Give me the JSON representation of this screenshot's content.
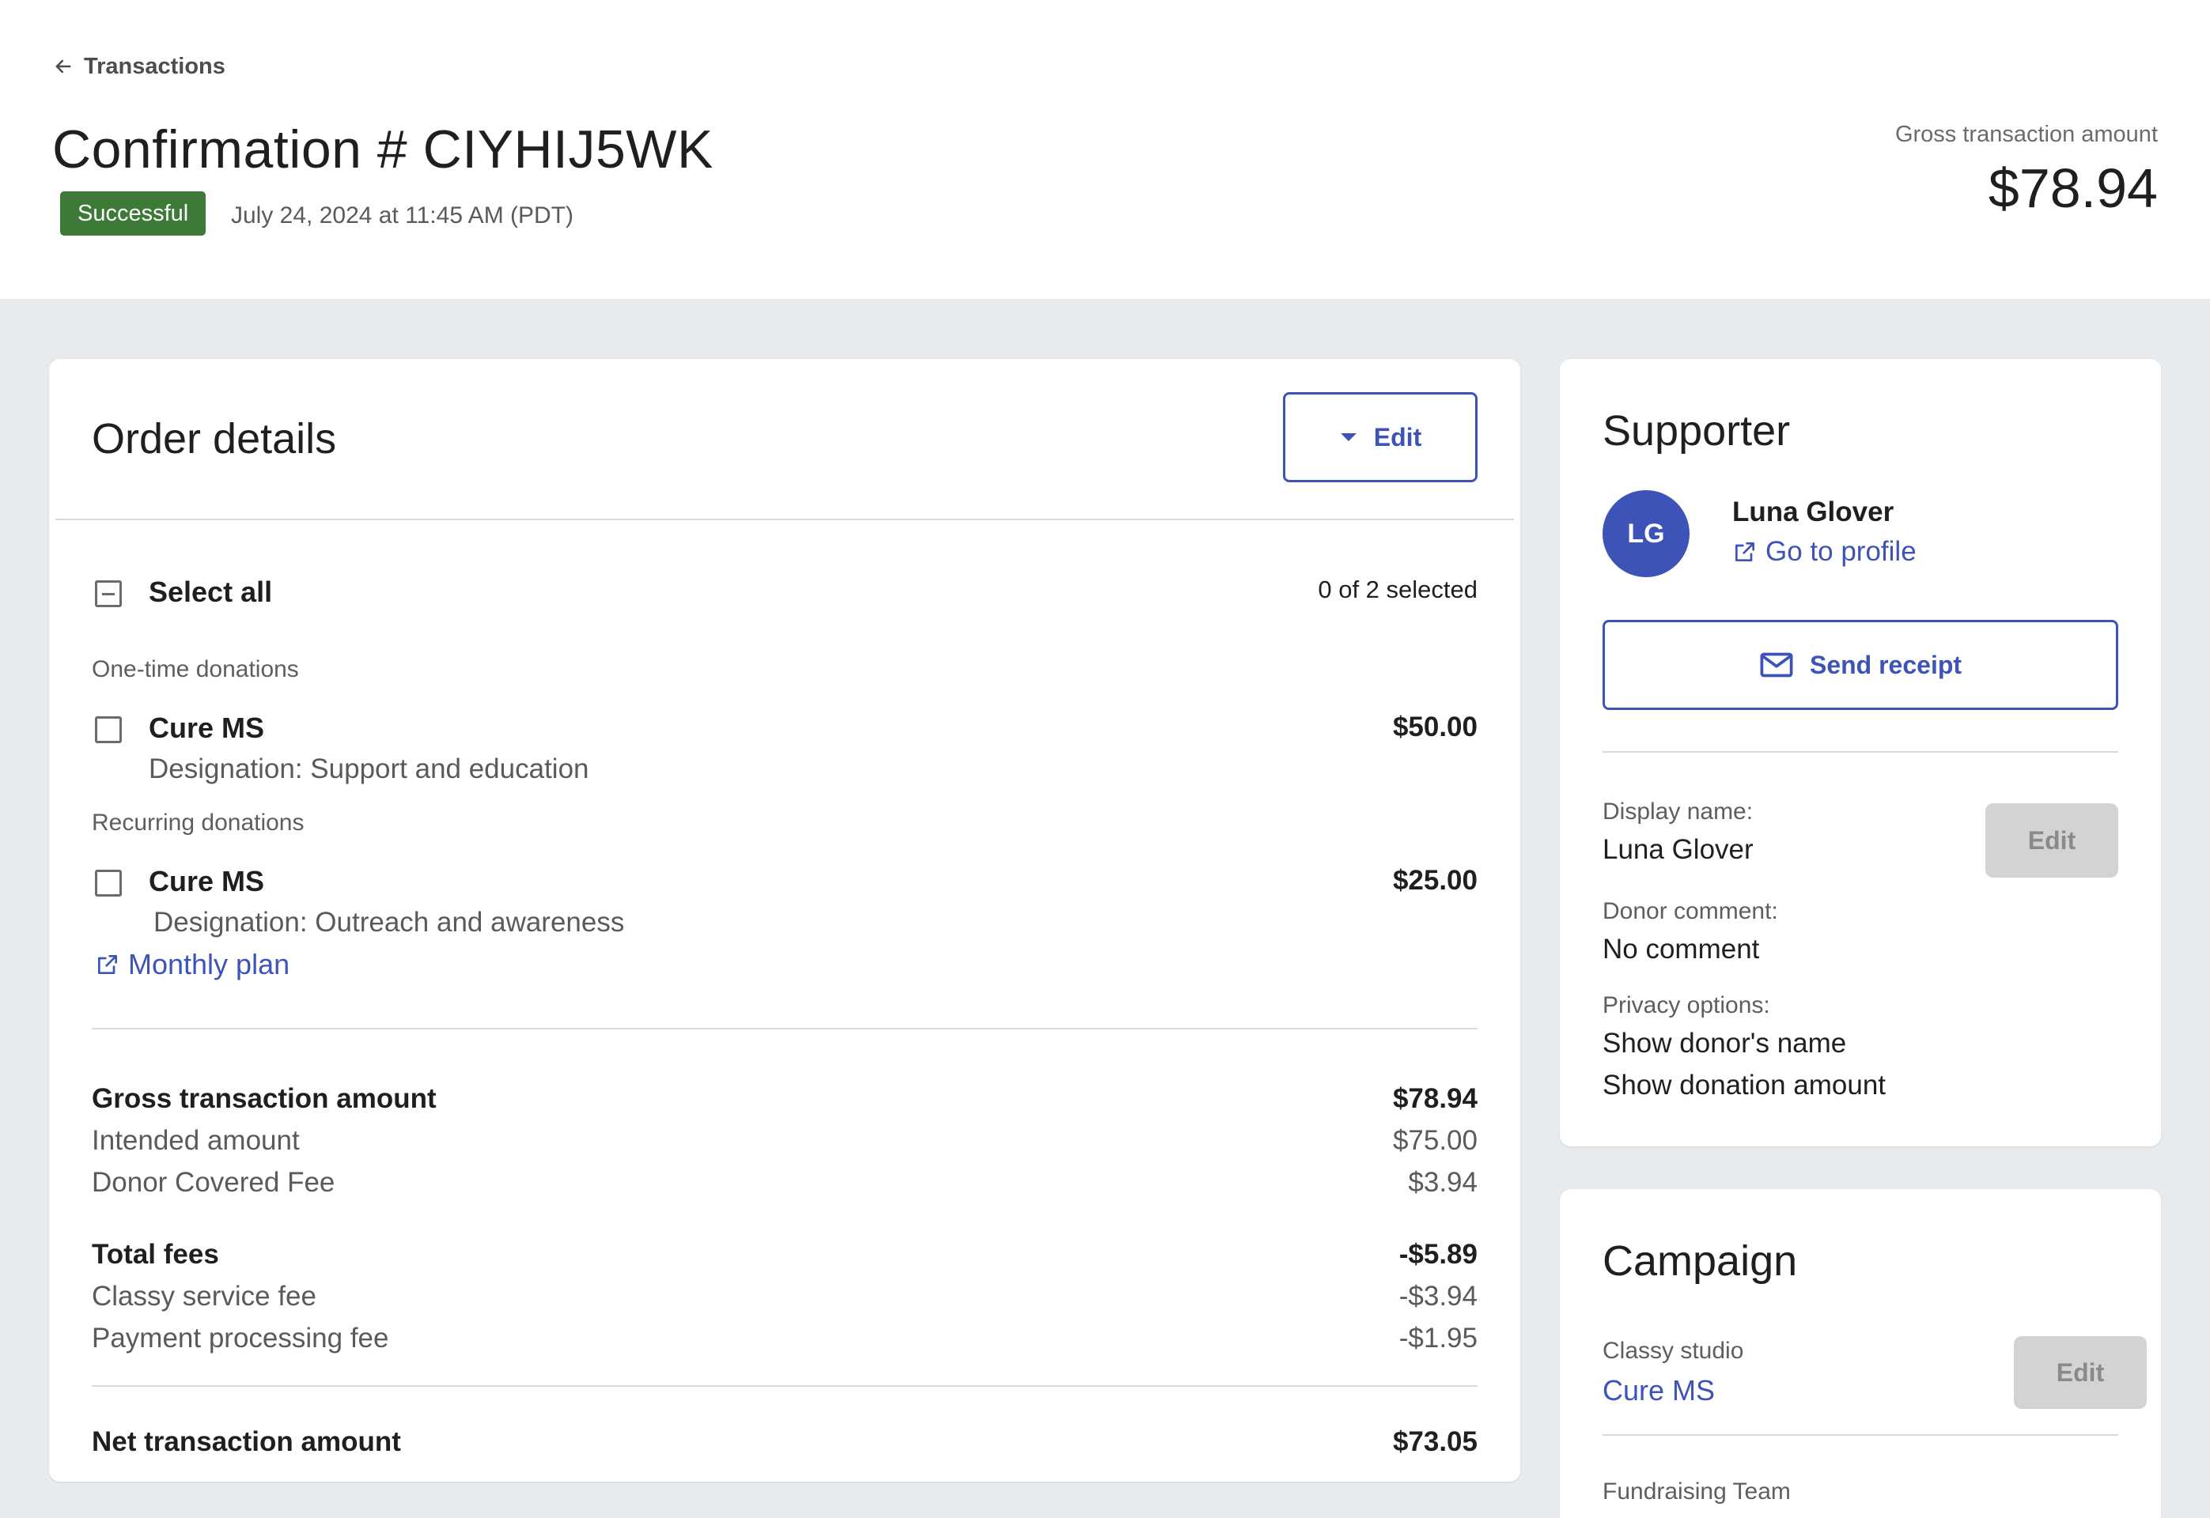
{
  "header": {
    "back_label": "Transactions",
    "title": "Confirmation # CIYHIJ5WK",
    "status": "Successful",
    "date": "July 24, 2024 at 11:45 AM (PDT)",
    "gross_label": "Gross transaction amount",
    "gross_value": "$78.94"
  },
  "order": {
    "title": "Order details",
    "edit_label": "Edit",
    "select_all_label": "Select all",
    "selected_count": "0 of 2 selected",
    "one_time_heading": "One-time donations",
    "recurring_heading": "Recurring donations",
    "items": [
      {
        "name": "Cure MS",
        "designation": "Designation: Support and education",
        "amount": "$50.00"
      },
      {
        "name": "Cure MS",
        "designation": "Designation: Outreach and awareness",
        "amount": "$25.00",
        "link": "Monthly plan"
      }
    ],
    "summary": {
      "gross_label": "Gross transaction amount",
      "gross_value": "$78.94",
      "intended_label": "Intended amount",
      "intended_value": "$75.00",
      "donor_fee_label": "Donor Covered Fee",
      "donor_fee_value": "$3.94",
      "total_fees_label": "Total fees",
      "total_fees_value": "-$5.89",
      "service_fee_label": "Classy service fee",
      "service_fee_value": "-$3.94",
      "processing_fee_label": "Payment processing fee",
      "processing_fee_value": "-$1.95",
      "net_label": "Net transaction amount",
      "net_value": "$73.05"
    }
  },
  "supporter": {
    "title": "Supporter",
    "initials": "LG",
    "name": "Luna Glover",
    "profile_link": "Go to profile",
    "send_receipt_label": "Send receipt",
    "display_name_label": "Display name:",
    "display_name_value": "Luna Glover",
    "edit_label": "Edit",
    "comment_label": "Donor comment:",
    "comment_value": "No comment",
    "privacy_label": "Privacy options:",
    "privacy_values": [
      "Show donor's name",
      "Show donation amount"
    ]
  },
  "campaign": {
    "title": "Campaign",
    "studio_label": "Classy studio",
    "campaign_name": "Cure MS",
    "edit_label": "Edit",
    "team_label": "Fundraising Team"
  },
  "colors": {
    "accent": "#3e53b8",
    "success": "#3e7a37",
    "background": "#e8ebee"
  }
}
